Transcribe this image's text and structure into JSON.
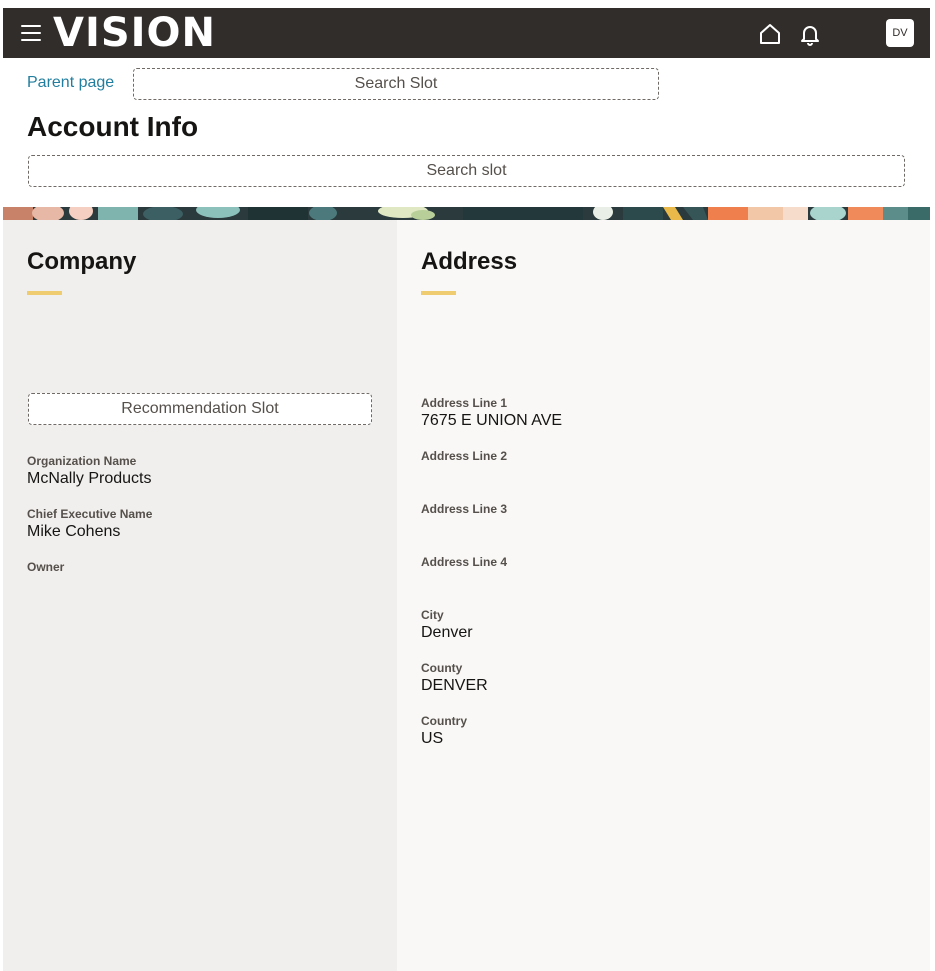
{
  "header": {
    "logo_text": "VISION",
    "avatar_initials": "DV",
    "icons": [
      "hamburger-menu-icon",
      "home-icon",
      "bell-icon"
    ]
  },
  "breadcrumb": {
    "parent_label": "Parent page"
  },
  "search": {
    "top_slot_label": "Search Slot",
    "wide_slot_label": "Search slot"
  },
  "page": {
    "title": "Account Info"
  },
  "company": {
    "title": "Company",
    "recommendation_slot_label": "Recommendation Slot",
    "fields": [
      {
        "label": "Organization Name",
        "value": "McNally Products"
      },
      {
        "label": "Chief Executive Name",
        "value": "Mike Cohens"
      },
      {
        "label": "Owner",
        "value": ""
      }
    ]
  },
  "address": {
    "title": "Address",
    "fields": [
      {
        "label": "Address Line 1",
        "value": "7675 E UNION AVE"
      },
      {
        "label": "Address Line 2",
        "value": ""
      },
      {
        "label": "Address Line 3",
        "value": ""
      },
      {
        "label": "Address Line 4",
        "value": ""
      },
      {
        "label": "City",
        "value": "Denver"
      },
      {
        "label": "County",
        "value": "DENVER"
      },
      {
        "label": "Country",
        "value": "US"
      }
    ]
  },
  "colors": {
    "header_bg": "#312d2a",
    "link": "#227e9e",
    "accent": "#f0cc71",
    "left_panel_bg": "#f1efed",
    "right_panel_bg": "#f9f8f6"
  }
}
